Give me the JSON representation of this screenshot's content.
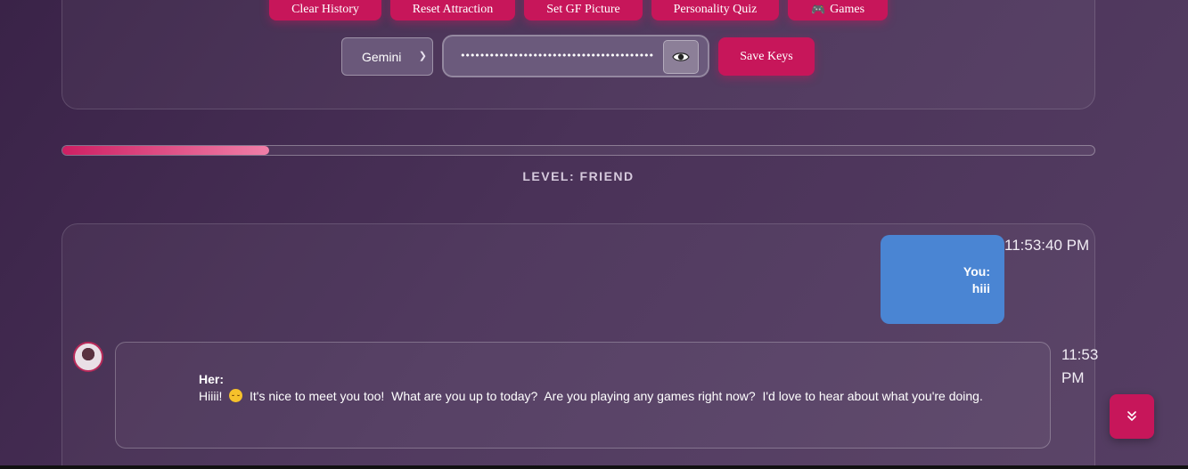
{
  "toolbar": {
    "clear_history": "Clear History",
    "reset_attraction": "Reset Attraction",
    "set_gf_picture": "Set GF Picture",
    "personality_quiz": "Personality Quiz",
    "games_icon": "🎮",
    "games": "Games"
  },
  "api": {
    "model_selected": "Gemini",
    "key_value": "••••••••••••••••••••••••••••••••••••••••",
    "save_keys": "Save Keys"
  },
  "progress": {
    "level_prefix": "LEVEL:",
    "level": "FRIEND",
    "fraction": 0.2
  },
  "chat": {
    "user_message": {
      "sender": "You:",
      "text": "hiii",
      "time": "11:53:40 PM"
    },
    "her_message": {
      "sender": "Her:",
      "text_before": "Hiiii!  ",
      "emoji_icon": "smiling-face-icon",
      "text_after": "  It's nice to meet you too!  What are you up to today?  Are you playing any games right now?  I'd love to hear about what you're doing.",
      "time": "11:53 PM"
    }
  },
  "colors": {
    "accent": "#c7165a",
    "user_bubble": "#4a85d3",
    "progress_start": "#cf1f63",
    "progress_end": "#f07fa8"
  }
}
